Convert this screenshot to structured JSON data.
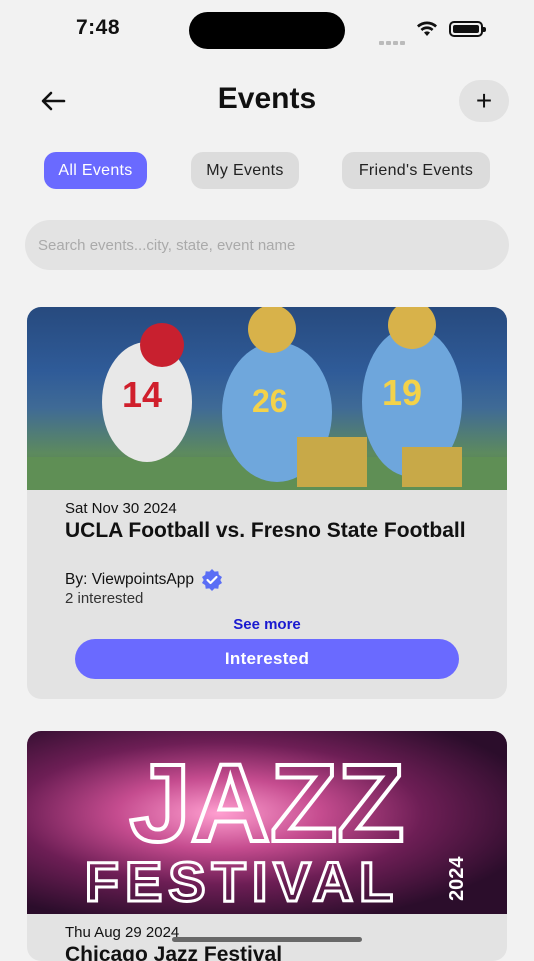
{
  "status": {
    "time": "7:48"
  },
  "header": {
    "title": "Events",
    "add_label": "+"
  },
  "tabs": [
    {
      "label": "All Events",
      "active": true
    },
    {
      "label": "My Events",
      "active": false
    },
    {
      "label": "Friend's Events",
      "active": false
    }
  ],
  "search": {
    "placeholder": "Search events...city, state, event name",
    "value": ""
  },
  "events": [
    {
      "date": "Sat Nov 30 2024",
      "title": "UCLA Football vs. Fresno State Football",
      "organizer": "By: ViewpointsApp",
      "interested_count": "2 interested",
      "see_more": "See more",
      "button": "Interested",
      "image_alt": "football game photo"
    },
    {
      "date": "Thu Aug 29 2024",
      "title": "Chicago Jazz Festival",
      "image_text_top": "JAZZ",
      "image_text_bottom": "FESTIVAL",
      "image_text_year": "2024"
    }
  ],
  "colors": {
    "accent": "#6a6aff",
    "link": "#1a1ad0",
    "card": "#e3e3e3",
    "background": "#f2f2f2"
  }
}
